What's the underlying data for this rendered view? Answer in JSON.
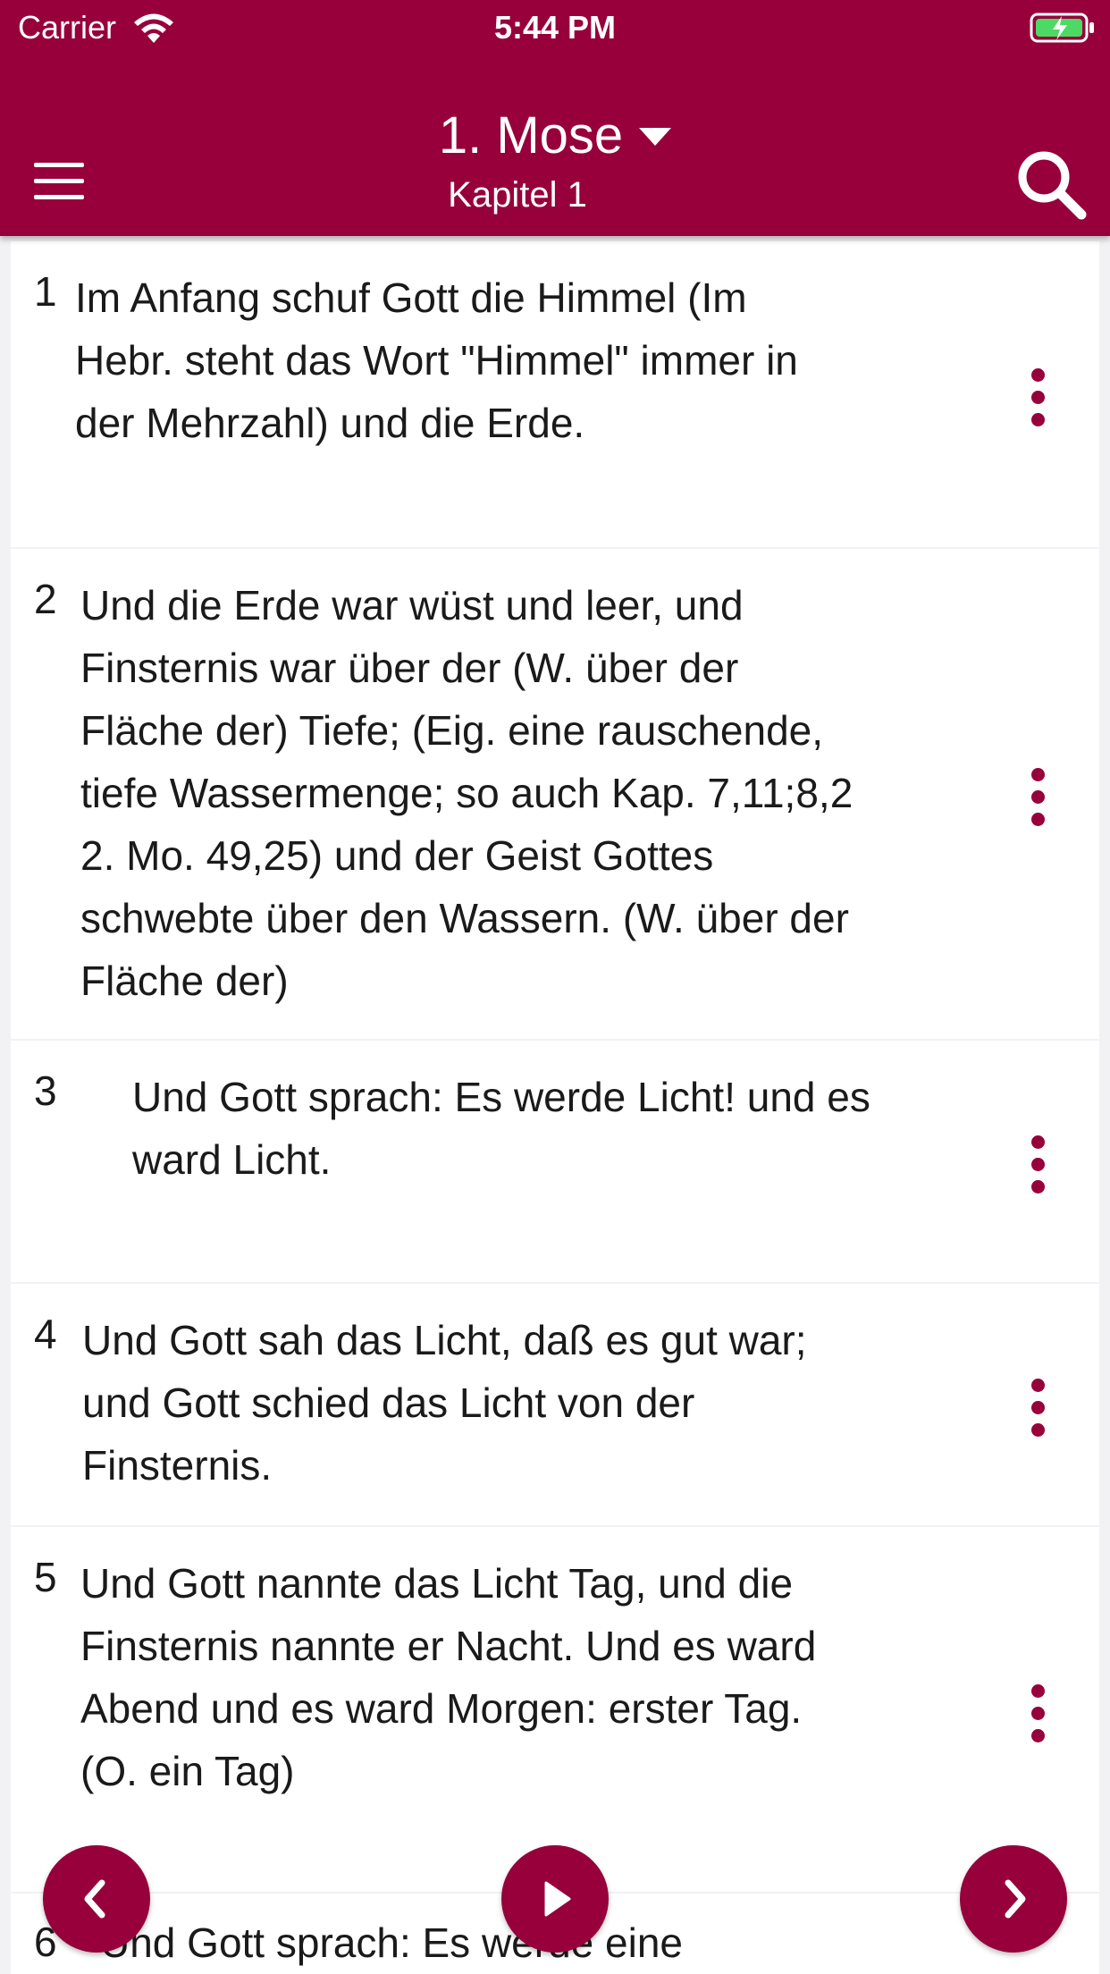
{
  "status_bar": {
    "carrier": "Carrier",
    "time": "5:44 PM"
  },
  "header": {
    "book": "1. Mose",
    "chapter": "Kapitel 1"
  },
  "verses": [
    {
      "number": "1",
      "lines": [
        "Im Anfang schuf Gott die Himmel  (Im",
        "Hebr. steht das Wort \"Himmel\" immer in",
        "der Mehrzahl)   und die Erde."
      ]
    },
    {
      "number": "2",
      "lines": [
        "Und die Erde war wüst und leer, und",
        "Finsternis war über der  (W. über der",
        "Fläche der)   Tiefe;  (Eig. eine rauschende,",
        "tiefe Wassermenge; so auch Kap. 7,11;8,2",
        "2. Mo. 49,25)   und der Geist Gottes",
        "schwebte über den Wassern.  (W. über der",
        "Fläche der)"
      ]
    },
    {
      "number": "3",
      "lines": [
        "Und Gott sprach: Es werde Licht! und es",
        "ward Licht."
      ]
    },
    {
      "number": "4",
      "lines": [
        "Und Gott sah das Licht, daß es gut war;",
        "und Gott schied das Licht von der",
        "Finsternis."
      ]
    },
    {
      "number": "5",
      "lines": [
        "Und Gott nannte das Licht Tag, und die",
        "Finsternis nannte er Nacht. Und es ward",
        "Abend und es ward Morgen: erster Tag.",
        "(O. ein Tag)"
      ]
    },
    {
      "number": "6",
      "lines": [
        "Und Gott sprach: Es werde eine"
      ]
    }
  ],
  "icons": {
    "menu": "menu-icon",
    "search": "search-icon",
    "more": "more-vertical-icon",
    "prev": "chevron-left-icon",
    "play": "play-icon",
    "next": "chevron-right-icon"
  },
  "colors": {
    "accent": "#97003b",
    "background": "#f2f2f4",
    "card": "#ffffff"
  }
}
